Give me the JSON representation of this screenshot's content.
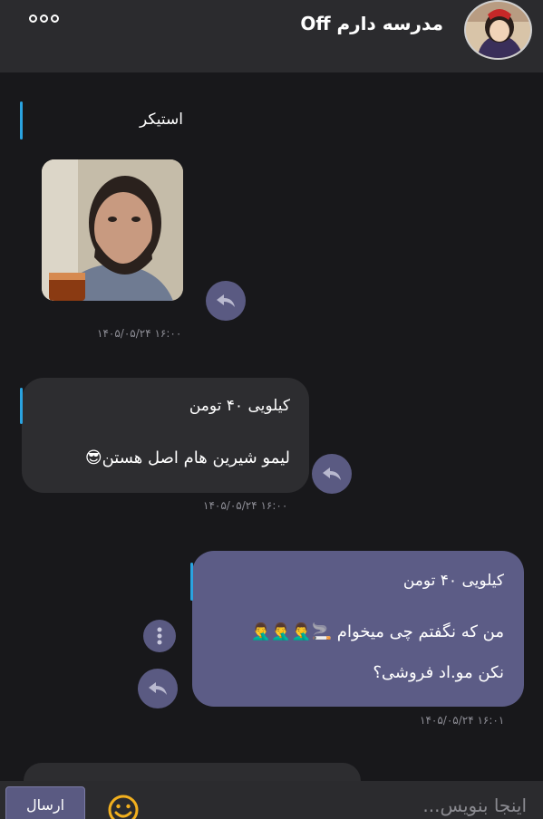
{
  "header": {
    "title": "مدرسه دارم Off"
  },
  "messages": [
    {
      "reply_quote": "استیکر",
      "timestamp": "۱۴۰۵/۰۵/۲۴ ۱۶:۰۰"
    },
    {
      "reply_quote": "کیلویی ۴۰ تومن",
      "text": "لیمو شیرین هام اصل هستن😎",
      "timestamp": "۱۴۰۵/۰۵/۲۴ ۱۶:۰۰"
    },
    {
      "reply_quote": "کیلویی ۴۰ تومن",
      "line1": "من که نگفتم چی میخوام 🚬🤦‍♂️🤦‍♂️🤦‍♂️",
      "line2": "نکن مو.اد فروشی؟",
      "timestamp": "۱۴۰۵/۰۵/۲۴ ۱۶:۰۱"
    }
  ],
  "composer": {
    "send_label": "ارسال",
    "placeholder": "اینجا بنویس..."
  },
  "colors": {
    "background": "#18181b",
    "header": "#2b2b2e",
    "incoming_bubble": "#2d2d30",
    "outgoing_bubble": "#5c5c86",
    "reply_accent": "#2aa3e0"
  }
}
